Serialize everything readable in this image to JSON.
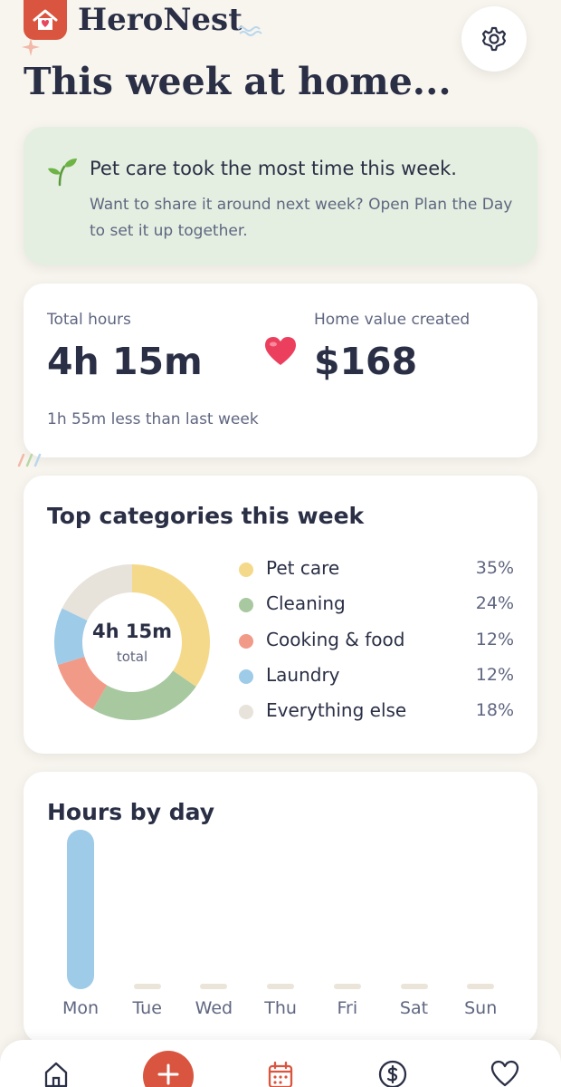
{
  "header": {
    "app_name": "HeroNest",
    "title": "This week at home..."
  },
  "icons": {
    "logo": "house-heart-icon",
    "settings": "gear-icon",
    "insight": "sprout-icon",
    "value": "heart-icon"
  },
  "colors": {
    "brand": "#d9553f",
    "insight_background": "#e4efe1",
    "text_dark": "#2a2f45",
    "text_muted": "#5f6680"
  },
  "insight": {
    "title": "Pet care took the most time this week.",
    "body": "Want to share it around next week? Open Plan the Day to set it up together."
  },
  "stats": {
    "total_hours_label": "Total hours",
    "total_hours_value": "4h 15m",
    "home_value_label": "Home value created",
    "home_value_value": "$168",
    "comparison": "1h 55m less than last week"
  },
  "categories": {
    "title": "Top categories this week",
    "center_value": "4h 15m",
    "center_caption": "total",
    "items": [
      {
        "label": "Pet care",
        "percent": "35%",
        "value": 35,
        "color": "#f5d98b"
      },
      {
        "label": "Cleaning",
        "percent": "24%",
        "value": 24,
        "color": "#a8c8a0"
      },
      {
        "label": "Cooking & food",
        "percent": "12%",
        "value": 12,
        "color": "#f29a88"
      },
      {
        "label": "Laundry",
        "percent": "12%",
        "value": 12,
        "color": "#9ecbe8"
      },
      {
        "label": "Everything else",
        "percent": "18%",
        "value": 18,
        "color": "#e7e2da"
      }
    ]
  },
  "hours_by_day": {
    "title": "Hours by day",
    "days": [
      {
        "label": "Mon",
        "hours": 4.25
      },
      {
        "label": "Tue",
        "hours": 0
      },
      {
        "label": "Wed",
        "hours": 0
      },
      {
        "label": "Thu",
        "hours": 0
      },
      {
        "label": "Fri",
        "hours": 0
      },
      {
        "label": "Sat",
        "hours": 0
      },
      {
        "label": "Sun",
        "hours": 0
      }
    ]
  },
  "chart_data": [
    {
      "type": "pie",
      "title": "Top categories this week",
      "categories": [
        "Pet care",
        "Cleaning",
        "Cooking & food",
        "Laundry",
        "Everything else"
      ],
      "values": [
        35,
        24,
        12,
        12,
        18
      ]
    },
    {
      "type": "bar",
      "title": "Hours by day",
      "categories": [
        "Mon",
        "Tue",
        "Wed",
        "Thu",
        "Fri",
        "Sat",
        "Sun"
      ],
      "values": [
        4.25,
        0,
        0,
        0,
        0,
        0,
        0
      ]
    }
  ],
  "tab_bar": {
    "tabs": [
      {
        "name": "home",
        "icon": "home-icon"
      },
      {
        "name": "add",
        "icon": "plus-icon"
      },
      {
        "name": "calendar",
        "icon": "calendar-icon"
      },
      {
        "name": "money",
        "icon": "dollar-circle-icon"
      },
      {
        "name": "favorites",
        "icon": "heart-outline-icon"
      }
    ]
  }
}
